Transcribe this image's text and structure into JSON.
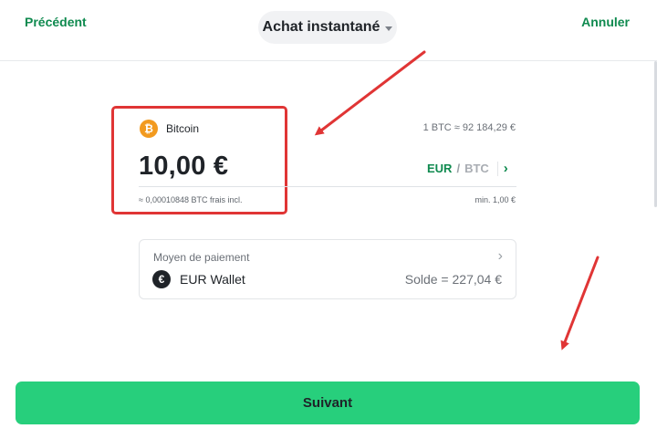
{
  "header": {
    "back_label": "Précédent",
    "title": "Achat instantané",
    "cancel_label": "Annuler"
  },
  "order": {
    "coin_icon_glyph": "₿",
    "coin_icon": "bitcoin-icon",
    "coin_name": "Bitcoin",
    "rate": "1 BTC ≈ 92 184,29 €",
    "amount": "10,00 €",
    "unit_primary": "EUR",
    "unit_separator": "/",
    "unit_secondary": "BTC",
    "unit_chevron": "›",
    "fees_note": "≈ 0,00010848 BTC frais incl.",
    "min_note": "min. 1,00 €"
  },
  "payment": {
    "label": "Moyen de paiement",
    "chevron": "›",
    "wallet_icon_glyph": "€",
    "wallet_icon": "euro-icon",
    "wallet_name": "EUR Wallet",
    "balance": "Solde = 227,04 €"
  },
  "footer": {
    "next_label": "Suivant"
  },
  "colors": {
    "accent_green": "#27cf7c",
    "link_green": "#0f8a4f",
    "bitcoin_orange": "#f29a1f",
    "annotation_red": "#e03535"
  }
}
